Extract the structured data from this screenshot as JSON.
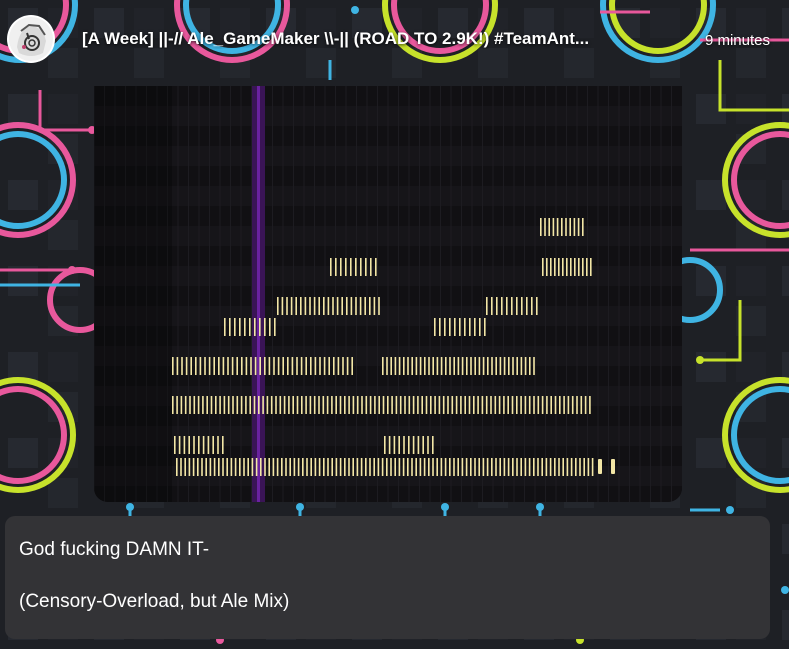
{
  "post": {
    "title": "[A Week] ||-// Ale_GameMaker \\\\-|| (ROAD TO 2.9K!) #TeamAnt...",
    "time": "9 minutes"
  },
  "caption": {
    "line1": "God fucking DAMN IT-",
    "line2": "(Censory-Overload, but Ale Mix)"
  },
  "icons": {
    "avatar": "avatar-icon"
  },
  "colors": {
    "background": "#1d1f24",
    "ring_pink": "#e8589c",
    "ring_blue": "#3fb4e3",
    "ring_lime": "#c7e22b",
    "playhead": "#5b1a8a",
    "note": "#f3e7a6",
    "caption_bg": "#333336"
  }
}
